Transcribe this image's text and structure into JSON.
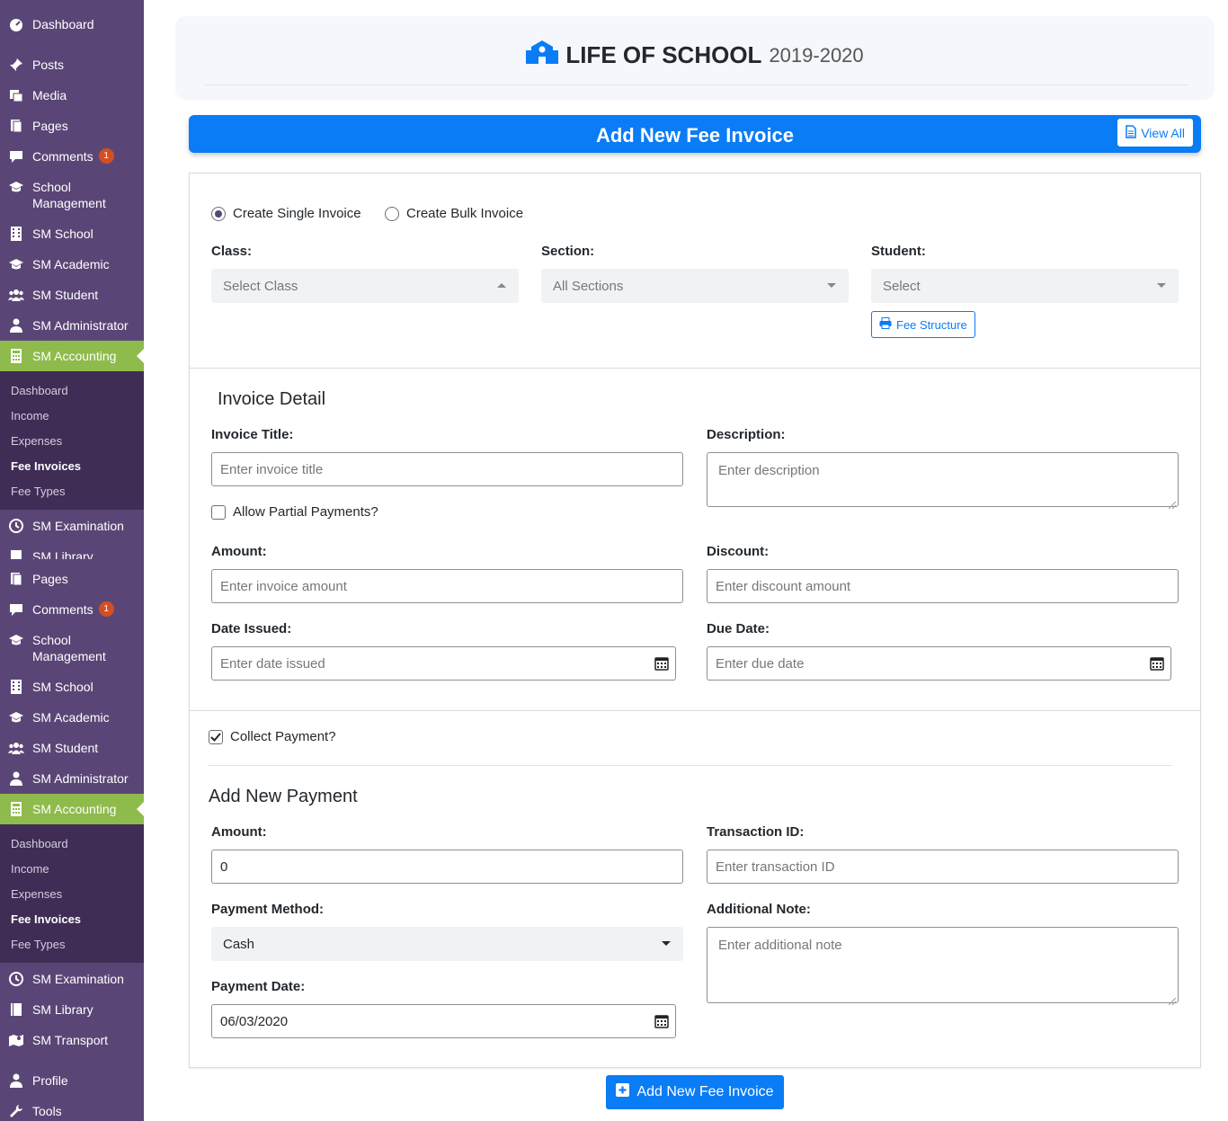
{
  "sidebar": {
    "dashboard": "Dashboard",
    "posts": "Posts",
    "media": "Media",
    "pages": "Pages",
    "comments": "Comments",
    "comments_count": "1",
    "school_management": "School Management",
    "sm_school": "SM School",
    "sm_academic": "SM Academic",
    "sm_student": "SM Student",
    "sm_administrator": "SM Administrator",
    "sm_accounting": "SM Accounting",
    "sub": {
      "dashboard": "Dashboard",
      "income": "Income",
      "expenses": "Expenses",
      "fee_invoices": "Fee Invoices",
      "fee_types": "Fee Types"
    },
    "sm_examination": "SM Examination",
    "sm_library": "SM Library",
    "sm_transport": "SM Transport",
    "profile": "Profile",
    "tools": "Tools"
  },
  "header": {
    "app_name": "LIFE OF SCHOOL",
    "session": "2019-2020"
  },
  "title_bar": {
    "title": "Add New Fee Invoice",
    "view_all": "View All"
  },
  "invoice_type": {
    "single": "Create Single Invoice",
    "bulk": "Create Bulk Invoice",
    "selected": "single"
  },
  "filters": {
    "class_label": "Class:",
    "class_value": "Select Class",
    "section_label": "Section:",
    "section_value": "All Sections",
    "student_label": "Student:",
    "student_value": "Select",
    "fee_structure": "Fee Structure"
  },
  "invoice_detail": {
    "heading": "Invoice Detail",
    "title_label": "Invoice Title:",
    "title_placeholder": "Enter invoice title",
    "description_label": "Description:",
    "description_placeholder": "Enter description",
    "partial_label": "Allow Partial Payments?",
    "amount_label": "Amount:",
    "amount_placeholder": "Enter invoice amount",
    "discount_label": "Discount:",
    "discount_placeholder": "Enter discount amount",
    "date_issued_label": "Date Issued:",
    "date_issued_placeholder": "Enter date issued",
    "due_date_label": "Due Date:",
    "due_date_placeholder": "Enter due date"
  },
  "payment": {
    "collect_label": "Collect Payment?",
    "heading": "Add New Payment",
    "amount_label": "Amount:",
    "amount_value": "0",
    "transaction_label": "Transaction ID:",
    "transaction_placeholder": "Enter transaction ID",
    "method_label": "Payment Method:",
    "method_value": "Cash",
    "note_label": "Additional Note:",
    "note_placeholder": "Enter additional note",
    "date_label": "Payment Date:",
    "date_value": "06/03/2020"
  },
  "submit_label": "Add New Fee Invoice",
  "colors": {
    "sidebar_bg": "#5a4676",
    "submenu_bg": "#3f2d55",
    "active_menu": "#8fba4c",
    "primary": "#0a7cf5",
    "badge": "#d54e21"
  }
}
